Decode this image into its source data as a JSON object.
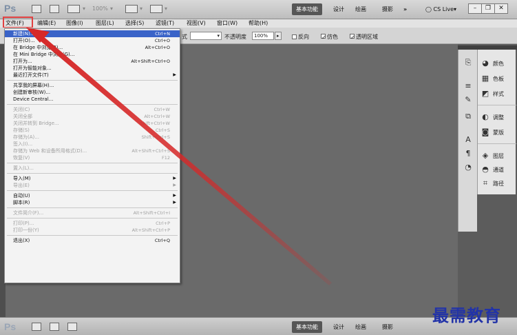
{
  "app": {
    "logo": "Ps",
    "zoom": "100%",
    "workspaces": [
      "基本功能",
      "设计",
      "绘画",
      "摄影",
      "»"
    ],
    "cslive": "CS Live"
  },
  "menubar": {
    "items": [
      "文件(F)",
      "编辑(E)",
      "图像(I)",
      "图层(L)",
      "选择(S)",
      "滤镜(T)",
      "视图(V)",
      "窗口(W)",
      "帮助(H)"
    ]
  },
  "options": {
    "mode_fragment": "式",
    "opacity_label": "不透明度",
    "opacity_value": "100%",
    "reverse_label": "反向",
    "dither_label": "仿色",
    "transparency_label": "透明区域"
  },
  "file_menu": [
    {
      "label": "新建(N)...",
      "shortcut": "Ctrl+N",
      "state": "selected"
    },
    {
      "label": "打开(O)...",
      "shortcut": "Ctrl+O",
      "state": "normal"
    },
    {
      "label": "在 Bridge 中浏览(B)...",
      "shortcut": "Alt+Ctrl+O",
      "state": "normal"
    },
    {
      "label": "在 Mini Bridge 中浏览(G)...",
      "shortcut": "",
      "state": "normal"
    },
    {
      "label": "打开为...",
      "shortcut": "Alt+Shift+Ctrl+O",
      "state": "normal"
    },
    {
      "label": "打开为智能对象...",
      "shortcut": "",
      "state": "normal"
    },
    {
      "label": "最近打开文件(T)",
      "shortcut": "",
      "state": "submenu"
    },
    {
      "label": "sep"
    },
    {
      "label": "共享我的屏幕(H)...",
      "shortcut": "",
      "state": "normal"
    },
    {
      "label": "创建新审核(W)...",
      "shortcut": "",
      "state": "normal"
    },
    {
      "label": "Device Central...",
      "shortcut": "",
      "state": "normal"
    },
    {
      "label": "sep"
    },
    {
      "label": "关闭(C)",
      "shortcut": "Ctrl+W",
      "state": "disabled"
    },
    {
      "label": "关闭全部",
      "shortcut": "Alt+Ctrl+W",
      "state": "disabled"
    },
    {
      "label": "关闭并转到 Bridge...",
      "shortcut": "Shift+Ctrl+W",
      "state": "disabled"
    },
    {
      "label": "存储(S)",
      "shortcut": "Ctrl+S",
      "state": "disabled"
    },
    {
      "label": "存储为(A)...",
      "shortcut": "Shift+Ctrl+S",
      "state": "disabled"
    },
    {
      "label": "签入(I)...",
      "shortcut": "",
      "state": "disabled"
    },
    {
      "label": "存储为 Web 和设备所用格式(D)...",
      "shortcut": "Alt+Shift+Ctrl+S",
      "state": "disabled"
    },
    {
      "label": "恢复(V)",
      "shortcut": "F12",
      "state": "disabled"
    },
    {
      "label": "sep"
    },
    {
      "label": "置入(L)...",
      "shortcut": "",
      "state": "disabled"
    },
    {
      "label": "sep"
    },
    {
      "label": "导入(M)",
      "shortcut": "",
      "state": "submenu"
    },
    {
      "label": "导出(E)",
      "shortcut": "",
      "state": "submenu-disabled"
    },
    {
      "label": "sep"
    },
    {
      "label": "自动(U)",
      "shortcut": "",
      "state": "submenu"
    },
    {
      "label": "脚本(R)",
      "shortcut": "",
      "state": "submenu"
    },
    {
      "label": "sep"
    },
    {
      "label": "文件简介(F)...",
      "shortcut": "Alt+Shift+Ctrl+I",
      "state": "disabled"
    },
    {
      "label": "sep"
    },
    {
      "label": "打印(P)...",
      "shortcut": "Ctrl+P",
      "state": "disabled"
    },
    {
      "label": "打印一份(Y)",
      "shortcut": "Alt+Shift+Ctrl+P",
      "state": "disabled"
    },
    {
      "label": "sep"
    },
    {
      "label": "退出(X)",
      "shortcut": "Ctrl+Q",
      "state": "normal"
    }
  ],
  "panels": {
    "group1": [
      {
        "icon": "palette-icon",
        "label": "颜色"
      },
      {
        "icon": "swatches-icon",
        "label": "色板"
      },
      {
        "icon": "styles-icon",
        "label": "样式"
      }
    ],
    "group2": [
      {
        "icon": "adjustments-icon",
        "label": "调整"
      },
      {
        "icon": "masks-icon",
        "label": "蒙版"
      }
    ],
    "group3": [
      {
        "icon": "layers-icon",
        "label": "图层"
      },
      {
        "icon": "channels-icon",
        "label": "通道"
      },
      {
        "icon": "paths-icon",
        "label": "路径"
      }
    ]
  },
  "bottom": {
    "logo": "Ps",
    "workspaces": [
      "基本功能",
      "设计",
      "绘画",
      "摄影"
    ]
  },
  "watermark": "最需教育",
  "colors": {
    "menu_selected": "#3a63c8",
    "highlight_box": "#e04040",
    "arrow": "#d62828",
    "watermark": "#2233a8"
  }
}
